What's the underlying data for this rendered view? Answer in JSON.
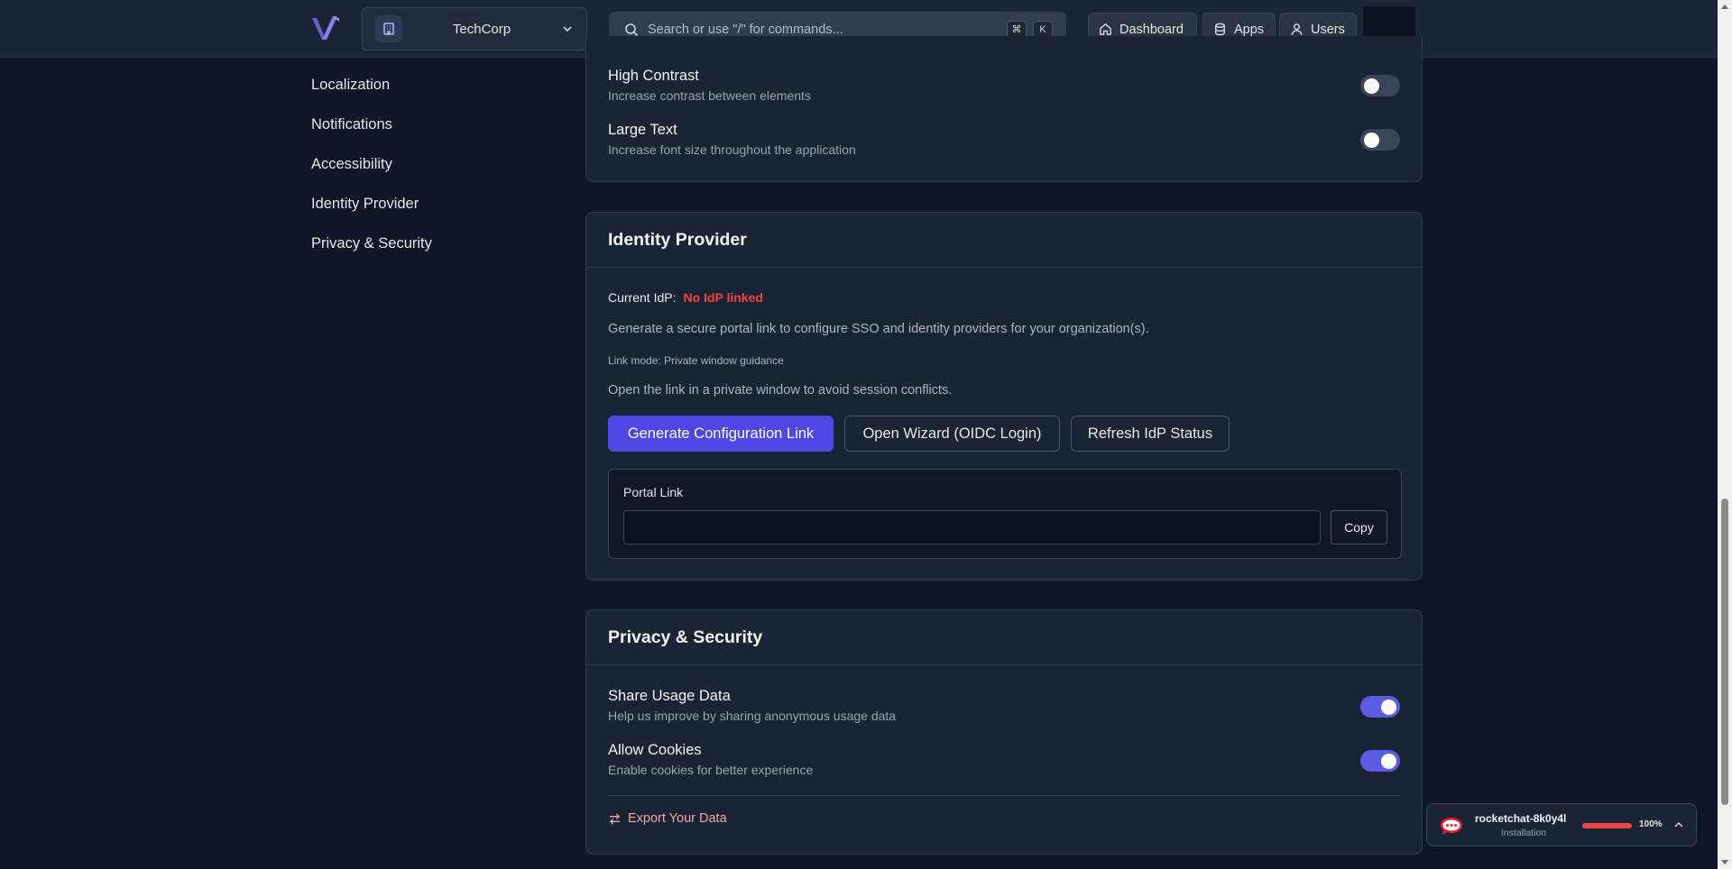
{
  "topbar": {
    "org_name": "TechCorp",
    "search_placeholder": "Search or use \"/\" for commands...",
    "shortcut_keys": [
      "⌘",
      "K"
    ],
    "nav": {
      "dashboard": "Dashboard",
      "apps": "Apps",
      "users": "Users"
    }
  },
  "sidebar": {
    "items": [
      {
        "label": "Localization"
      },
      {
        "label": "Notifications"
      },
      {
        "label": "Accessibility"
      },
      {
        "label": "Identity Provider"
      },
      {
        "label": "Privacy & Security"
      }
    ]
  },
  "accessibility": {
    "settings": [
      {
        "title": "High Contrast",
        "desc": "Increase contrast between elements",
        "enabled": false
      },
      {
        "title": "Large Text",
        "desc": "Increase font size throughout the application",
        "enabled": false
      }
    ]
  },
  "identity_provider": {
    "heading": "Identity Provider",
    "current_label": "Current IdP:",
    "current_value": "No IdP linked",
    "description": "Generate a secure portal link to configure SSO and identity providers for your organization(s).",
    "link_mode": "Link mode: Private window guidance",
    "note": "Open the link in a private window to avoid session conflicts.",
    "buttons": {
      "generate": "Generate Configuration Link",
      "wizard": "Open Wizard (OIDC Login)",
      "refresh": "Refresh IdP Status"
    },
    "portal": {
      "label": "Portal Link",
      "value": "",
      "copy": "Copy"
    }
  },
  "privacy": {
    "heading": "Privacy & Security",
    "settings": [
      {
        "title": "Share Usage Data",
        "desc": "Help us improve by sharing anonymous usage data",
        "enabled": true
      },
      {
        "title": "Allow Cookies",
        "desc": "Enable cookies for better experience",
        "enabled": true
      }
    ],
    "export": "Export Your Data"
  },
  "install_widget": {
    "name": "rocketchat-8k0y4l",
    "status": "Installation",
    "progress": 1.0,
    "progress_text": "100%"
  },
  "colors": {
    "accent": "#4f46e5",
    "danger": "#ef4444",
    "toggle_on": "#5b5ce0"
  }
}
